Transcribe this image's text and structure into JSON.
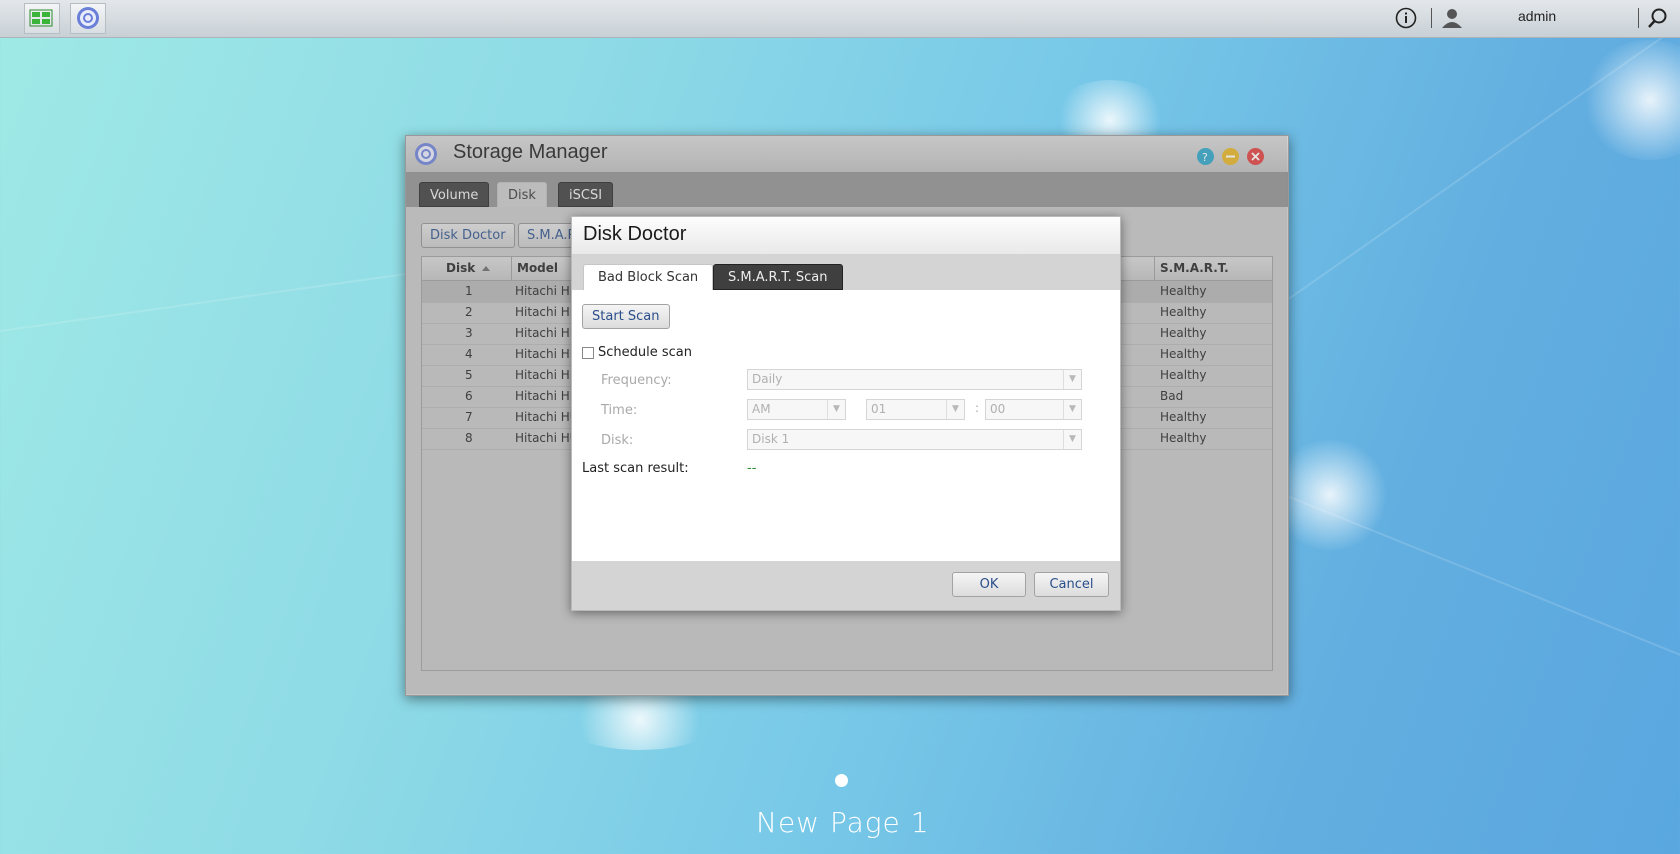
{
  "taskbar": {
    "user_name": "admin",
    "icons": [
      "apps-grid-icon",
      "storage-manager-icon",
      "info-icon",
      "user-icon",
      "search-icon"
    ]
  },
  "window": {
    "title": "Storage Manager",
    "tabs": [
      {
        "label": "Volume",
        "active": false
      },
      {
        "label": "Disk",
        "active": true
      },
      {
        "label": "iSCSI",
        "active": false
      }
    ],
    "toolbar": {
      "disk_doctor": "Disk Doctor",
      "smart_partial": "S.M.A.R"
    },
    "grid": {
      "columns": {
        "disk": "Disk",
        "model": "Model",
        "smart": "S.M.A.R.T."
      },
      "rows": [
        {
          "disk": "1",
          "model": "Hitachi HD",
          "smart": "Healthy"
        },
        {
          "disk": "2",
          "model": "Hitachi HD",
          "smart": "Healthy"
        },
        {
          "disk": "3",
          "model": "Hitachi HD",
          "smart": "Healthy"
        },
        {
          "disk": "4",
          "model": "Hitachi HD",
          "smart": "Healthy"
        },
        {
          "disk": "5",
          "model": "Hitachi HD",
          "smart": "Healthy"
        },
        {
          "disk": "6",
          "model": "Hitachi HD",
          "smart": "Bad"
        },
        {
          "disk": "7",
          "model": "Hitachi HU",
          "smart": "Healthy"
        },
        {
          "disk": "8",
          "model": "Hitachi HU",
          "smart": "Healthy"
        }
      ]
    }
  },
  "dialog": {
    "title": "Disk Doctor",
    "tabs": [
      {
        "label": "Bad Block Scan",
        "active": true
      },
      {
        "label": "S.M.A.R.T. Scan",
        "active": false
      }
    ],
    "start_scan": "Start Scan",
    "schedule_label": "Schedule scan",
    "schedule_checked": false,
    "frequency": {
      "label": "Frequency:",
      "value": "Daily"
    },
    "time": {
      "label": "Time:",
      "ampm": "AM",
      "hour": "01",
      "separator": ":",
      "minute": "00"
    },
    "disk": {
      "label": "Disk:",
      "value": "Disk 1"
    },
    "last_result": {
      "label": "Last scan result:",
      "value": "--"
    },
    "ok": "OK",
    "cancel": "Cancel"
  },
  "desktop": {
    "page_label": "New Page 1"
  }
}
